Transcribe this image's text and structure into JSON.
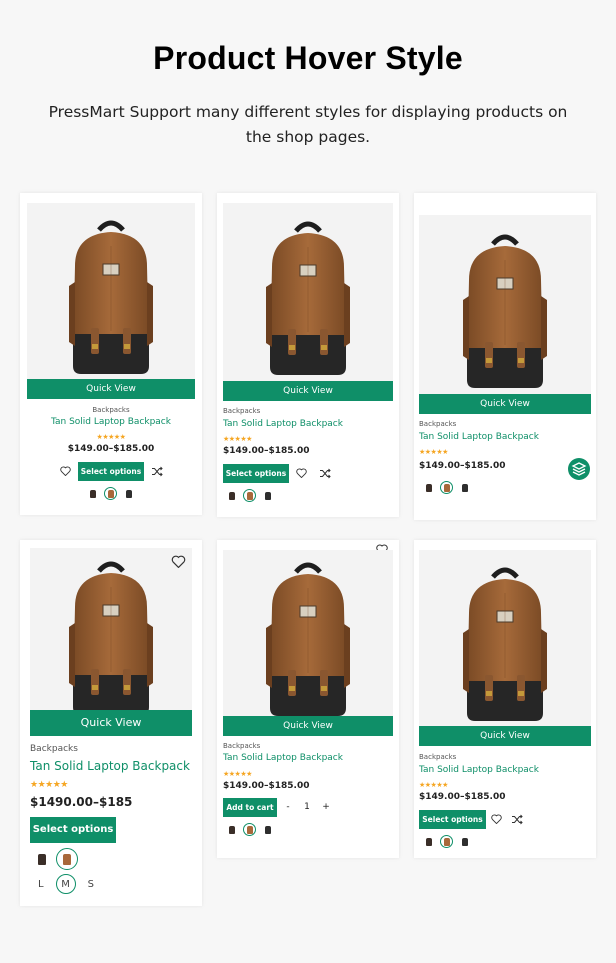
{
  "header": {
    "title": "Product Hover Style",
    "subtitle": "PressMart Support many different styles for displaying products on the shop pages."
  },
  "colors": {
    "accent": "#0f8f68",
    "stars": "#f5a623",
    "background": "#f7f7f7"
  },
  "cards": [
    {
      "quick_view": "Quick View",
      "category": "Backpacks",
      "name": "Tan Solid Laptop Backpack",
      "price": "$149.00–$185.00",
      "button": "Select options",
      "rating": "★★★★★",
      "icons": [
        "heart-icon",
        "shuffle-icon"
      ]
    },
    {
      "quick_view": "Quick View",
      "category": "Backpacks",
      "name": "Tan Solid Laptop Backpack",
      "price": "$149.00–$185.00",
      "button": "Select options",
      "rating": "★★★★★",
      "icons": [
        "heart-icon",
        "shuffle-icon"
      ]
    },
    {
      "quick_view": "Quick View",
      "category": "Backpacks",
      "name": "Tan Solid Laptop Backpack",
      "price": "$149.00–$185.00",
      "rating": "★★★★★",
      "icons": [
        "heart-icon",
        "layers-icon"
      ]
    },
    {
      "quick_view": "Quick View",
      "category": "Backpacks",
      "name": "Tan Solid Laptop Backpack",
      "price": "$1490.00–$185",
      "button": "Select options",
      "rating": "★★★★★",
      "sizes": [
        "L",
        "M",
        "S"
      ],
      "selected_size": "M",
      "icons": [
        "heart-icon"
      ]
    },
    {
      "quick_view": "Quick View",
      "category": "Backpacks",
      "name": "Tan Solid Laptop Backpack",
      "price": "$149.00–$185.00",
      "button": "Add to cart",
      "qty_minus": "-",
      "qty_value": "1",
      "qty_plus": "+",
      "rating": "★★★★★",
      "icons": [
        "heart-icon"
      ]
    },
    {
      "quick_view": "Quick View",
      "category": "Backpacks",
      "name": "Tan Solid Laptop Backpack",
      "price": "$149.00–$185.00",
      "button": "Select options",
      "rating": "★★★★★",
      "icons": [
        "heart-icon",
        "shuffle-icon"
      ]
    }
  ],
  "swatch_colors": [
    "#3a2e28",
    "#a8683a",
    "#2e2e2e"
  ]
}
